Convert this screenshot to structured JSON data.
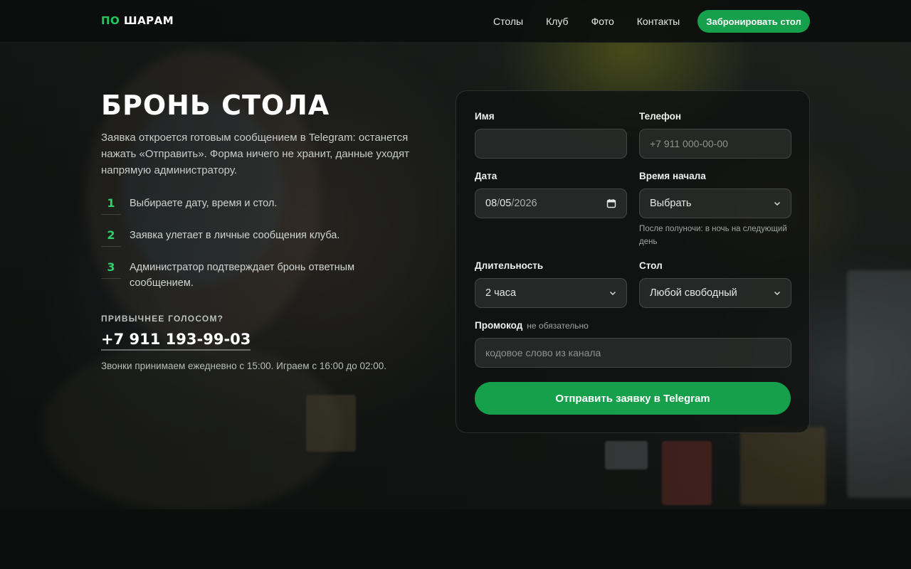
{
  "brand": {
    "logo_accent": "ПО",
    "logo_rest": " ШАРАМ",
    "accent_color": "#22c55e"
  },
  "nav": {
    "items": [
      {
        "label": "Столы"
      },
      {
        "label": "Клуб"
      },
      {
        "label": "Фото"
      },
      {
        "label": "Контакты"
      }
    ],
    "cta_label": "Забронировать стол"
  },
  "intro": {
    "title": "БРОНЬ СТОЛА",
    "lead": "Заявка откроется готовым сообщением в Telegram: останется нажать «Отправить». Форма ничего не хранит, данные уходят напрямую администратору.",
    "steps": [
      {
        "num": "1",
        "text": "Выбираете дату, время и стол."
      },
      {
        "num": "2",
        "text": "Заявка улетает в личные сообщения клуба."
      },
      {
        "num": "3",
        "text": "Администратор подтверждает бронь ответным сообщением."
      }
    ],
    "voice_label": "ПРИВЫЧНЕЕ ГОЛОСОМ?",
    "phone": "+7 911 193-99-03",
    "hours": "Звонки принимаем ежедневно с 15:00. Играем с 16:00 до 02:00."
  },
  "form": {
    "name": {
      "label": "Имя",
      "value": "",
      "placeholder": ""
    },
    "phone": {
      "label": "Телефон",
      "value": "",
      "placeholder": "+7 911 000-00-00"
    },
    "date": {
      "label": "Дата",
      "day": "08",
      "month": "05",
      "year": "2026",
      "sep": "/",
      "icon": "calendar-icon"
    },
    "start_time": {
      "label": "Время начала",
      "value": "Выбрать",
      "hint": "После полуночи: в ночь на следующий день"
    },
    "duration": {
      "label": "Длительность",
      "value": "2 часа"
    },
    "table": {
      "label": "Стол",
      "value": "Любой свободный"
    },
    "promo": {
      "label": "Промокод",
      "optional": "не обязательно",
      "value": "",
      "placeholder": "кодовое слово из канала"
    },
    "submit_label": "Отправить заявку в Telegram"
  }
}
